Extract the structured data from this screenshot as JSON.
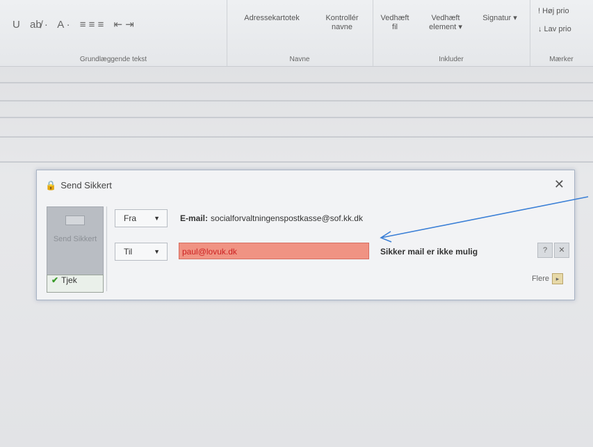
{
  "ribbon": {
    "formatting_row": [
      "U",
      "ab̸ ·",
      "A ·",
      "≡ ≡ ≡",
      "⇤ ⇥"
    ],
    "group1_label": "Grundlæggende tekst",
    "btn_adressekartotek": "Adressekartotek",
    "btn_kontroller_navne": "Kontrollér navne",
    "group2_label": "Navne",
    "btn_vedhaeft_fil": "Vedhæft fil",
    "btn_vedhaeft_element": "Vedhæft element ▾",
    "btn_signatur": "Signatur ▾",
    "group3_label": "Inkluder",
    "btn_flag_op": "! Høj prio",
    "btn_lav_prio": "↓ Lav prio",
    "group4_label": "Mærker"
  },
  "dialog": {
    "title": "Send Sikkert",
    "send_button": "Send Sikkert",
    "check_button": "Tjek",
    "from_dropdown": "Fra",
    "from_label": "E-mail:",
    "from_value": "socialforvaltningenspostkasse@sof.kk.dk",
    "to_dropdown": "Til",
    "to_value": "paul@lovuk.dk",
    "warning": "Sikker mail er ikke mulig",
    "more_label": "Flere"
  },
  "colors": {
    "to_field_bg": "#f09383",
    "annotation_arrow": "#3a7fd6"
  }
}
